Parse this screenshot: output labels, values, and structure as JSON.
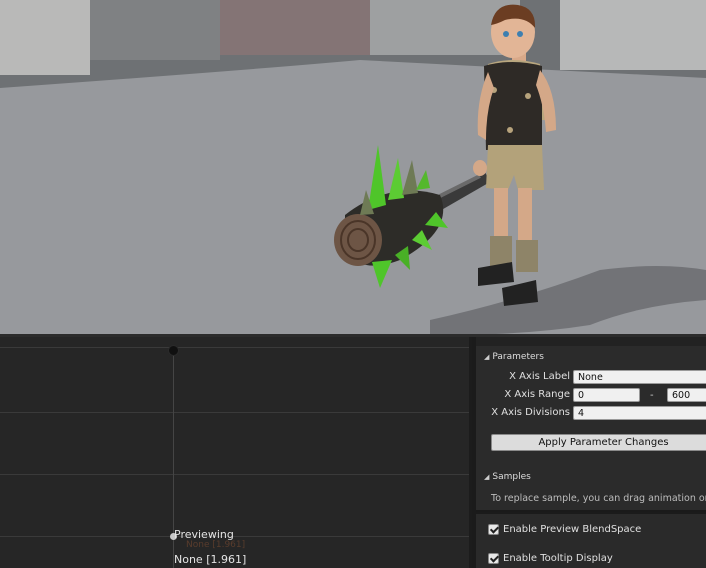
{
  "parameters": {
    "header": "Parameters",
    "x_axis_label": {
      "label": "X Axis Label",
      "value": "None"
    },
    "x_axis_range": {
      "label": "X Axis Range",
      "min": "0",
      "max": "600"
    },
    "x_axis_divisions": {
      "label": "X Axis Divisions",
      "value": "4"
    },
    "apply_button": "Apply Parameter Changes"
  },
  "samples": {
    "header": "Samples",
    "hint": "To replace sample, you can drag animation onto t"
  },
  "graph": {
    "previewing": "Previewing",
    "preview_anim": "None [1.961]"
  },
  "options": {
    "enable_preview": "Enable Preview BlendSpace",
    "enable_tooltip": "Enable Tooltip Display"
  },
  "colors": {
    "graph_bg": "#262626",
    "panel_bg": "#2b2b2b",
    "field_bg": "#f0f0f0"
  },
  "icons": {
    "section_arrow": "collapse-arrow-icon",
    "checkbox": "checkbox-checked-icon"
  }
}
